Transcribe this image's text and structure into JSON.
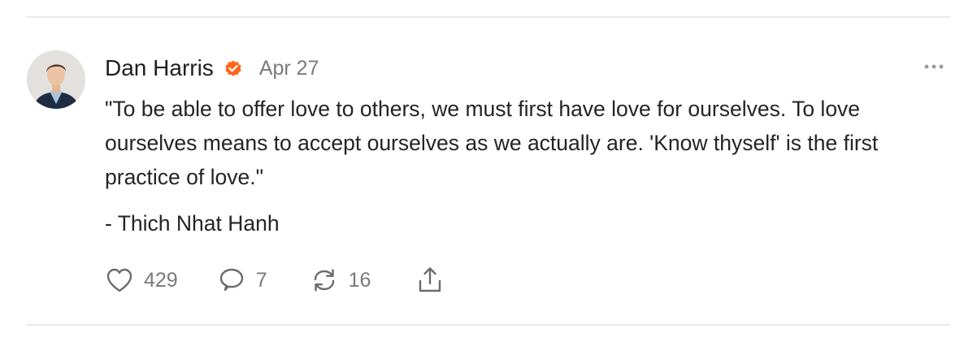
{
  "post": {
    "author": "Dan Harris",
    "verified": true,
    "date": "Apr 27",
    "quote": "\"To be able to offer love to others, we must first have love for ourselves. To love ourselves means to accept ourselves as we actually are. 'Know thyself' is the first practice of love.\"",
    "attribution": "- Thich Nhat Hanh"
  },
  "actions": {
    "likes": "429",
    "comments": "7",
    "restacks": "16"
  },
  "icons": {
    "verified": "verified-badge-icon",
    "more": "more-dots-icon",
    "like": "heart-icon",
    "comment": "comment-bubble-icon",
    "restack": "restack-icon",
    "share": "share-icon"
  },
  "colors": {
    "accent": "#ff6719",
    "text": "#242424",
    "muted": "#7a7a7a",
    "divider": "#e8e8e8"
  }
}
